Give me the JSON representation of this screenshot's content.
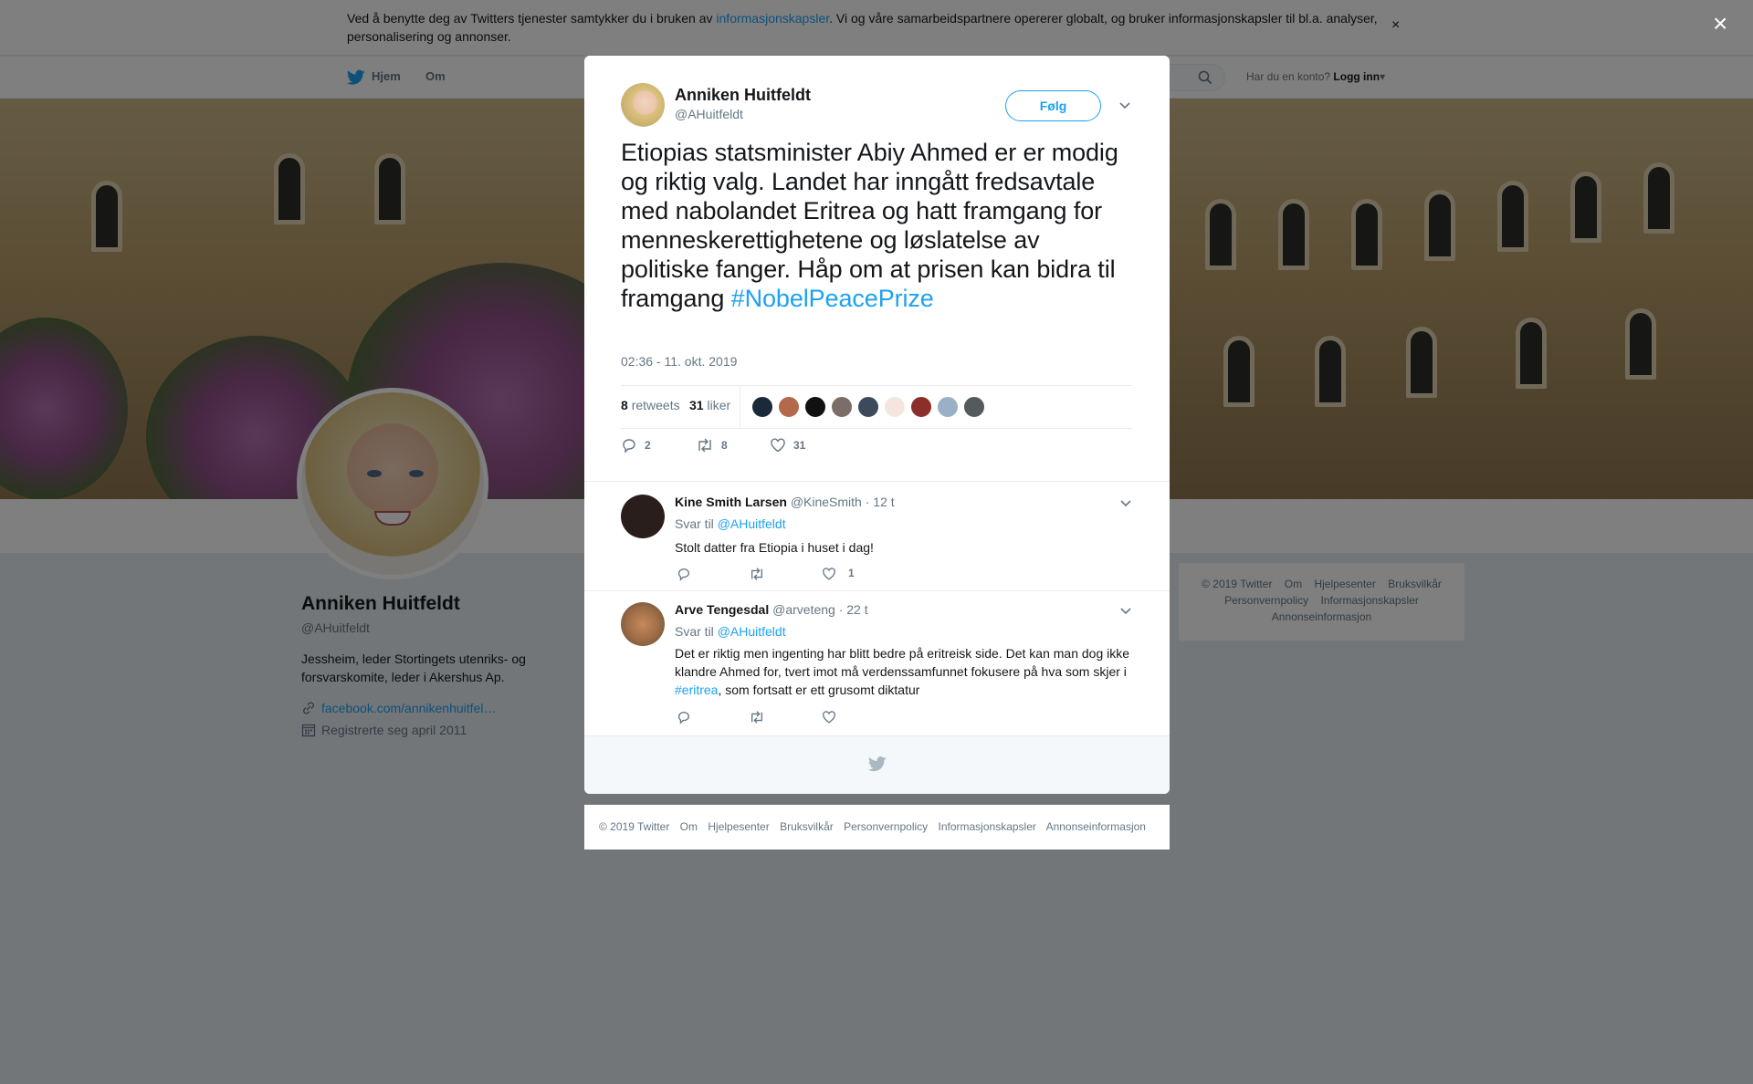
{
  "cookie": {
    "text_before": "Ved å benytte deg av Twitters tjenester samtykker du i bruken av ",
    "link": "informasjonskapsler",
    "text_after": ". Vi og våre samarbeidspartnere opererer globalt, og bruker informasjonskapsler til bl.a. analyser, personalisering og annonser.",
    "close": "×"
  },
  "nav": {
    "home": "Hjem",
    "about": "Om",
    "account_prompt": "Har du en konto?",
    "login": "Logg inn"
  },
  "profile": {
    "name": "Anniken Huitfeldt",
    "handle": "@AHuitfeldt",
    "bio": "Jessheim, leder Stortingets utenriks- og forsvarskomite, leder i Akershus Ap.",
    "link": "facebook.com/annikenhuitfel…",
    "joined": "Registrerte seg april 2011"
  },
  "side_footer": {
    "items": [
      "© 2019 Twitter",
      "Om",
      "Hjelpesenter",
      "Bruksvilkår",
      "Personvernpolicy",
      "Informasjonskapsler",
      "Annonseinformasjon"
    ]
  },
  "overlay_close": "×",
  "tweet": {
    "author_name": "Anniken Huitfeldt",
    "author_handle": "@AHuitfeldt",
    "follow_label": "Følg",
    "text": "Etiopias statsminister Abiy Ahmed er er modig og riktig valg. Landet har inngått fredsavtale med nabolandet Eritrea og hatt framgang for menneskerettighetene og løslatelse av politiske fanger. Håp om at prisen kan bidra til framgang ",
    "hashtag": "#NobelPeacePrize",
    "timestamp": "02:36 - 11. okt. 2019",
    "retweets": "8",
    "retweets_label": "retweets",
    "likes": "31",
    "likes_label": "liker",
    "reply_count": "2",
    "retweet_count": "8",
    "like_count": "31",
    "liker_colors": [
      "#1b2a3a",
      "#b36a4a",
      "#111111",
      "#7a6e66",
      "#3c4a5c",
      "#f4e6df",
      "#8c2f2a",
      "#9bb0c6",
      "#555a5f"
    ]
  },
  "replies": [
    {
      "name": "Kine Smith Larsen",
      "handle": "@KineSmith",
      "time": "· 12 t",
      "reply_to_label": "Svar til",
      "reply_to": "@AHuitfeldt",
      "text": "Stolt datter fra Etiopia i huset i dag!",
      "like_count": "1",
      "avatar_color": "#2a1e1c"
    },
    {
      "name": "Arve Tengesdal",
      "handle": "@arveteng",
      "time": "· 22 t",
      "reply_to_label": "Svar til",
      "reply_to": "@AHuitfeldt",
      "text_before": "Det er riktig men ingenting har blitt bedre på eritreisk side. Det kan man dog ikke klandre Ahmed for, tvert imot må verdenssamfunnet fokusere på hva som skjer i ",
      "hashtag": "#eritrea",
      "text_after": ", som fortsatt er ett grusomt diktatur",
      "like_count": "",
      "avatar_color": "#9a6a45"
    }
  ],
  "modal_footer": {
    "items": [
      "© 2019 Twitter",
      "Om",
      "Hjelpesenter",
      "Bruksvilkår",
      "Personvernpolicy",
      "Informasjonskapsler",
      "Annonseinformasjon"
    ]
  },
  "colors": {
    "accent": "#1da1f2",
    "text": "#14171a",
    "muted": "#657786"
  },
  "icons": [
    "twitter-bird-icon",
    "search-icon",
    "chevron-down-icon",
    "reply-icon",
    "retweet-icon",
    "heart-icon",
    "link-icon",
    "calendar-icon",
    "close-icon"
  ]
}
